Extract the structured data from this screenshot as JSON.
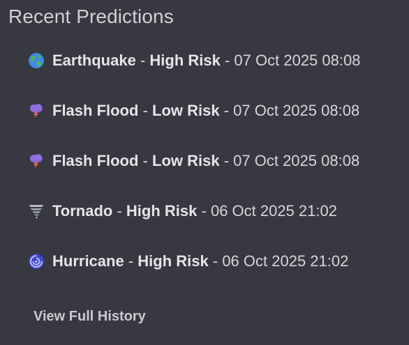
{
  "panel": {
    "title": "Recent Predictions"
  },
  "predictions": [
    {
      "icon": "globe-icon",
      "type": "Earthquake",
      "sep1": " - ",
      "risk": "High Risk",
      "sep2": " - ",
      "date": "07 Oct 2025 08:08"
    },
    {
      "icon": "storm-cloud-icon",
      "type": "Flash Flood",
      "sep1": " - ",
      "risk": "Low Risk",
      "sep2": " - ",
      "date": "07 Oct 2025 08:08"
    },
    {
      "icon": "storm-cloud-icon",
      "type": "Flash Flood",
      "sep1": " - ",
      "risk": "Low Risk",
      "sep2": " - ",
      "date": "07 Oct 2025 08:08"
    },
    {
      "icon": "tornado-icon",
      "type": "Tornado",
      "sep1": " - ",
      "risk": "High Risk",
      "sep2": " - ",
      "date": "06 Oct 2025 21:02"
    },
    {
      "icon": "cyclone-icon",
      "type": "Hurricane",
      "sep1": " - ",
      "risk": "High Risk",
      "sep2": " - ",
      "date": "06 Oct 2025 21:02"
    }
  ],
  "footer": {
    "history_label": "View Full History"
  },
  "colors": {
    "background": "#373840",
    "text": "#dcdde2"
  }
}
